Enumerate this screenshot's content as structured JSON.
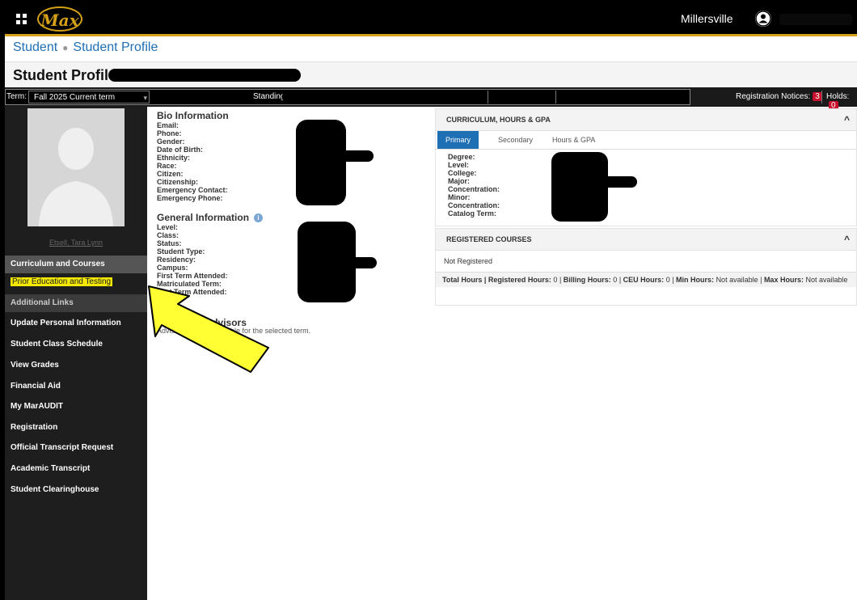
{
  "app": {
    "logo_text": "Max",
    "institution": "Millersville"
  },
  "breadcrumb": {
    "root": "Student",
    "current": "Student Profile"
  },
  "page": {
    "title": "Student Profile"
  },
  "term_bar": {
    "term_label": "Term:",
    "term_value": "Fall 2025 Current term",
    "standing_label": "Standing",
    "notices_label": "Registration Notices:",
    "notices_count": "3",
    "holds_label": "Holds:",
    "holds_count": "0"
  },
  "sidebar": {
    "photo_name": "Etsell, Tara Lynn",
    "items": [
      {
        "label": "Curriculum and Courses",
        "style": "section"
      },
      {
        "label": "Prior Education and Testing",
        "style": "highlight"
      },
      {
        "label": "Additional Links",
        "style": "section-dim"
      },
      {
        "label": "Update Personal Information",
        "style": "link"
      },
      {
        "label": "Student Class Schedule",
        "style": "link"
      },
      {
        "label": "View Grades",
        "style": "link"
      },
      {
        "label": "Financial Aid",
        "style": "link"
      },
      {
        "label": "My MarAUDIT",
        "style": "link"
      },
      {
        "label": "Registration",
        "style": "link"
      },
      {
        "label": "Official Transcript Request",
        "style": "link"
      },
      {
        "label": "Academic Transcript",
        "style": "link"
      },
      {
        "label": "Student Clearinghouse",
        "style": "link"
      }
    ]
  },
  "bio": {
    "heading": "Bio Information",
    "fields": [
      "Email:",
      "Phone:",
      "Gender:",
      "Date of Birth:",
      "Ethnicity:",
      "Race:",
      "Citizen:",
      "Citizenship:",
      "Emergency Contact:",
      "Emergency Phone:"
    ]
  },
  "general": {
    "heading": "General Information",
    "info_icon": "i",
    "fields": [
      "Level:",
      "Class:",
      "Status:",
      "Student Type:",
      "Residency:",
      "Campus:",
      "First Term Attended:",
      "Matriculated Term:",
      "Last Term Attended:"
    ]
  },
  "advisors": {
    "heading": "Reporting Advisors",
    "text": "Advisors are not available for the selected term."
  },
  "curriculum": {
    "heading": "CURRICULUM, HOURS & GPA",
    "tabs": [
      "Primary",
      "Secondary",
      "Hours & GPA"
    ],
    "fields": [
      "Degree:",
      "Level:",
      "College:",
      "Major:",
      "Concentration:",
      "Minor:",
      "Concentration:",
      "Catalog Term:"
    ]
  },
  "registered": {
    "heading": "REGISTERED COURSES",
    "status": "Not Registered",
    "summary": {
      "total_label": "Total Hours |",
      "registered_label": "Registered Hours:",
      "registered_value": "0",
      "billing_label": "Billing Hours:",
      "billing_value": "0",
      "ceu_label": "CEU Hours:",
      "ceu_value": "0",
      "min_label": "Min Hours:",
      "min_value": "Not available",
      "max_label": "Max Hours:",
      "max_value": "Not available"
    }
  },
  "colors": {
    "accent": "#d4a017",
    "link": "#1f6fb5",
    "highlight": "#f2e800",
    "arrow": "#ffff33"
  }
}
